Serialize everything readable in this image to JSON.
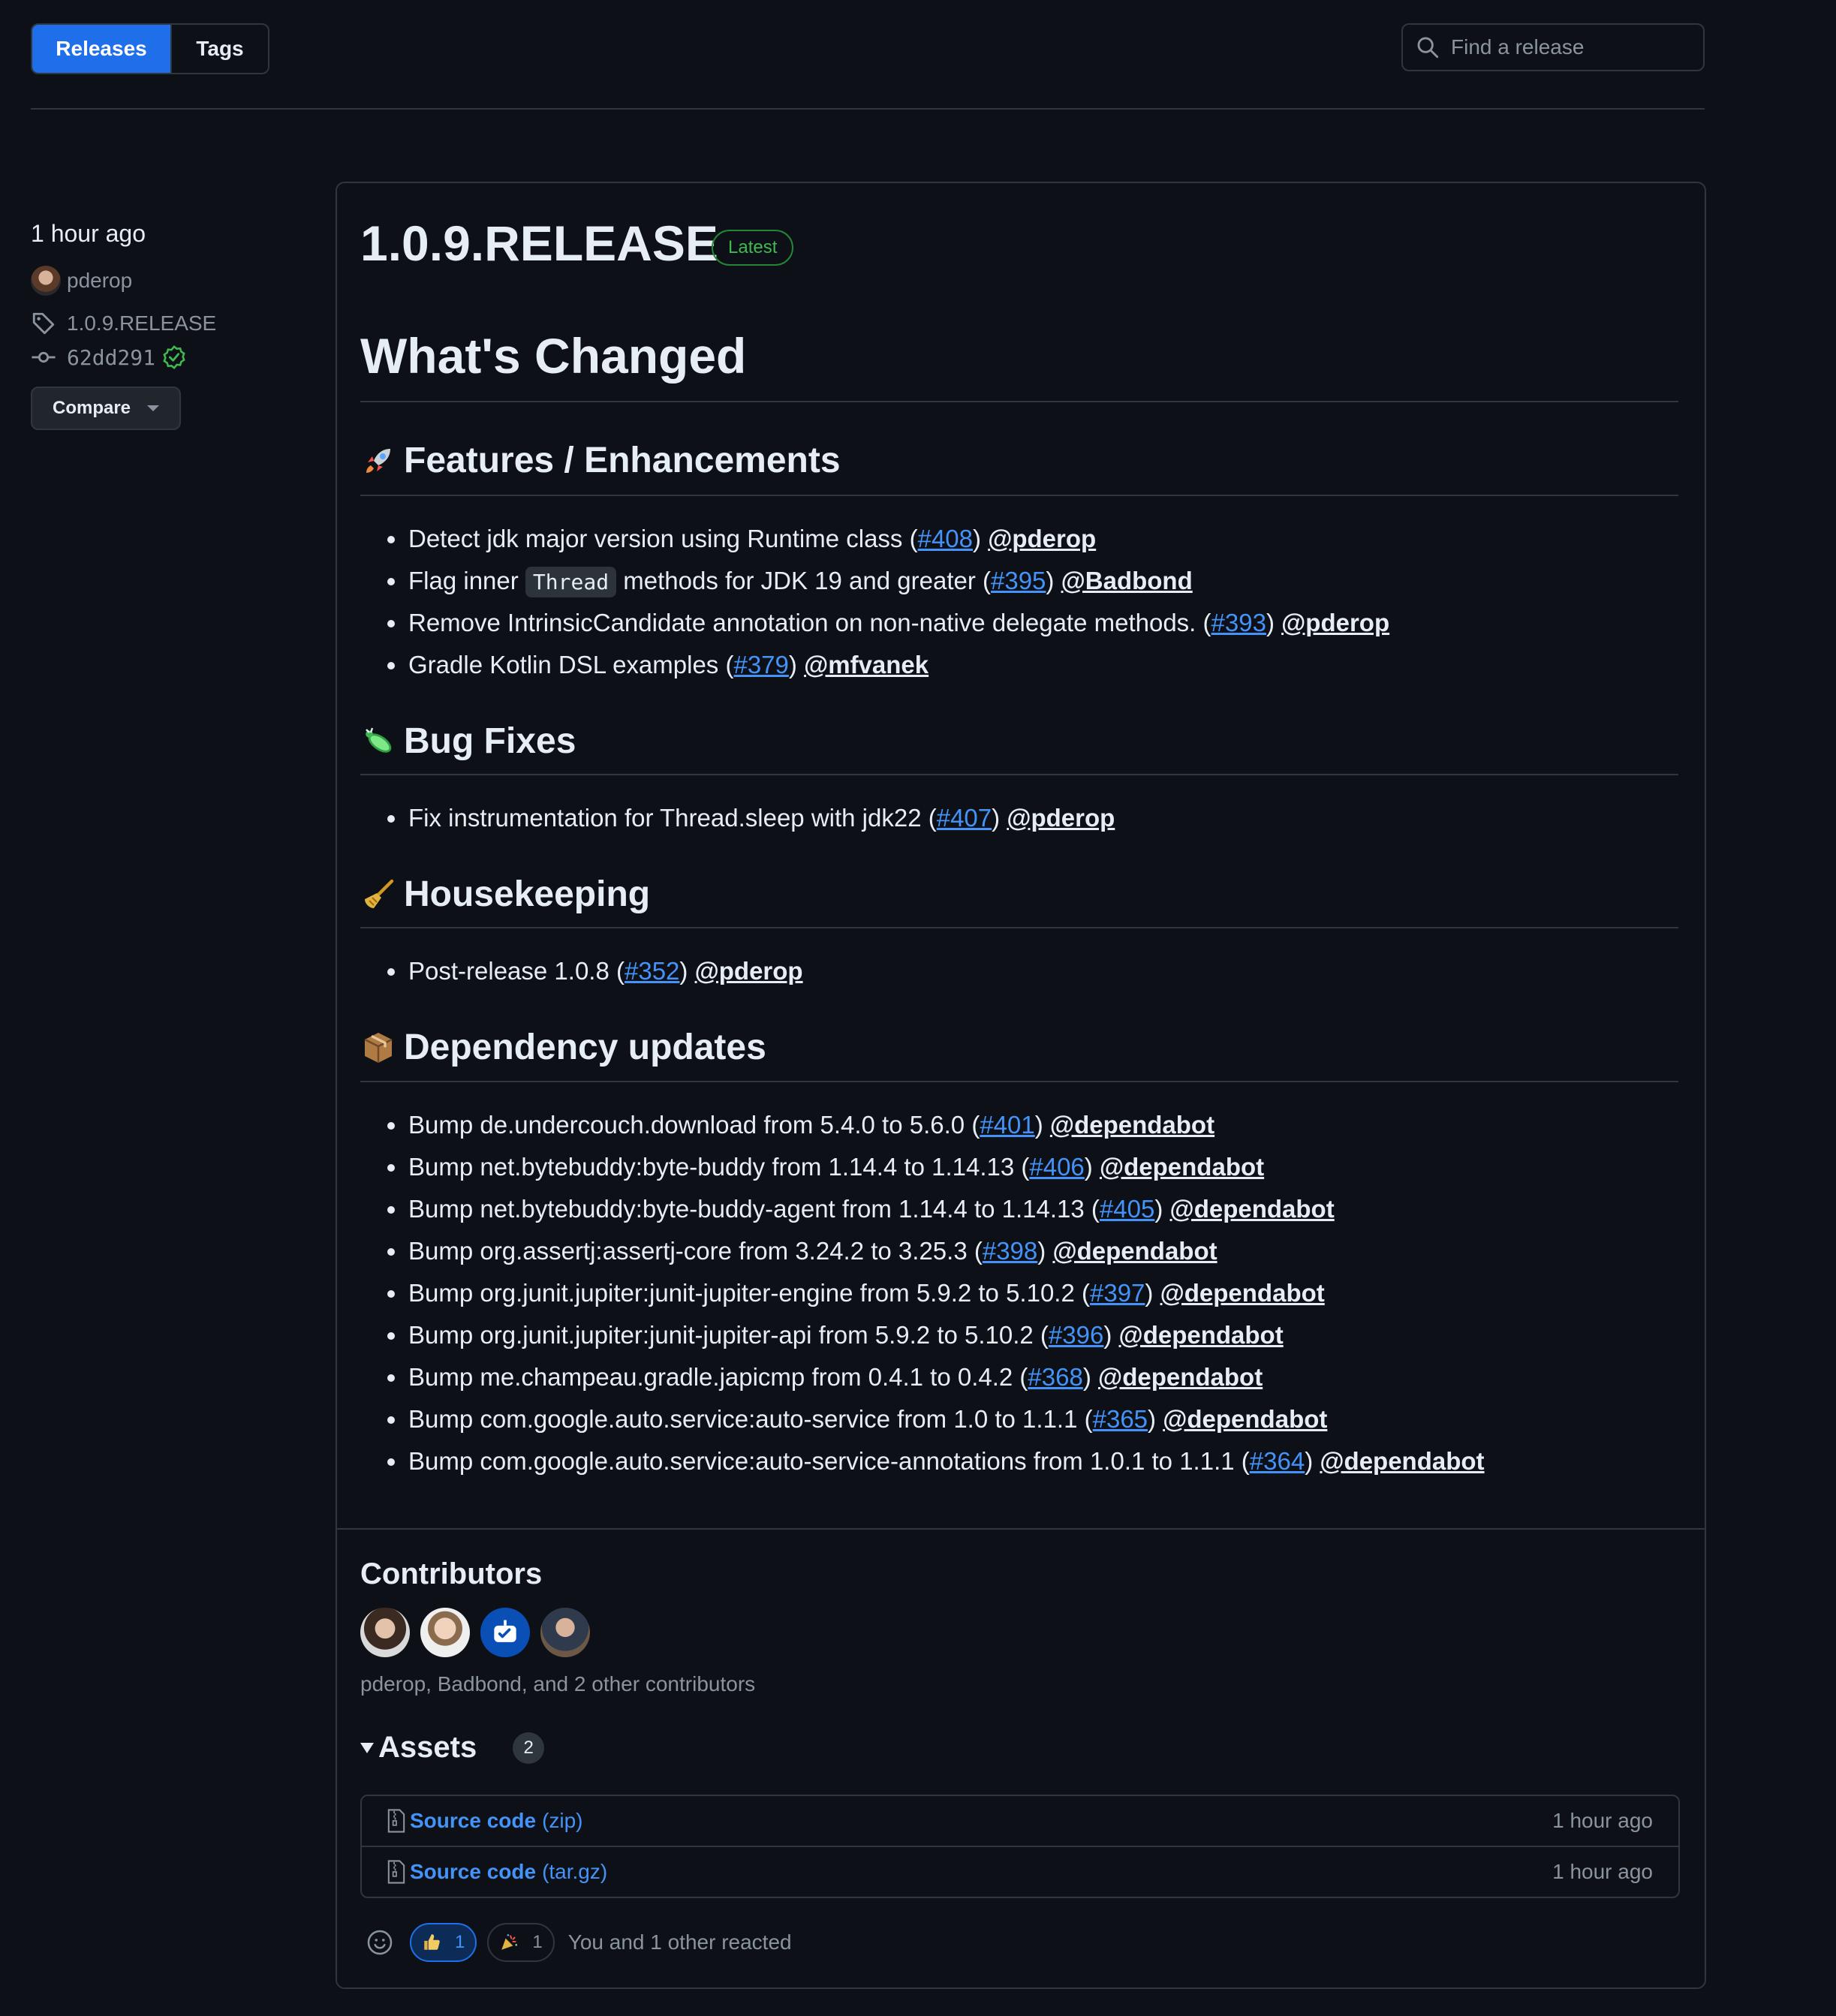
{
  "tabs": [
    {
      "label": "Releases",
      "active": true
    },
    {
      "label": "Tags",
      "active": false
    }
  ],
  "search": {
    "placeholder": "Find a release"
  },
  "meta": {
    "time": "1 hour ago",
    "author": "pderop",
    "tag": "1.0.9.RELEASE",
    "commit": "62dd291",
    "compare_label": "Compare"
  },
  "release": {
    "title": "1.0.9.RELEASE",
    "badge": "Latest",
    "heading": "What's Changed"
  },
  "sections": [
    {
      "title": "Features / Enhancements",
      "icon": "rocket-icon",
      "items": [
        {
          "pre": "Detect jdk major version using Runtime class (",
          "pr": "#408",
          "post": ")",
          "user": "@pderop"
        },
        {
          "pre": "Flag inner ",
          "code": "Thread",
          "mid": " methods for JDK 19 and greater (",
          "pr": "#395",
          "post": ")",
          "user": "@Badbond"
        },
        {
          "pre": "Remove IntrinsicCandidate annotation on non-native delegate methods. (",
          "pr": "#393",
          "post": ")",
          "user": "@pderop"
        },
        {
          "pre": "Gradle Kotlin DSL examples (",
          "pr": "#379",
          "post": ")",
          "user": "@mfvanek"
        }
      ]
    },
    {
      "title": "Bug Fixes",
      "icon": "bug-icon",
      "items": [
        {
          "pre": "Fix instrumentation for Thread.sleep with jdk22 (",
          "pr": "#407",
          "post": ")",
          "user": "@pderop"
        }
      ]
    },
    {
      "title": "Housekeeping",
      "icon": "broom-icon",
      "items": [
        {
          "pre": "Post-release 1.0.8 (",
          "pr": "#352",
          "post": ")",
          "user": "@pderop"
        }
      ]
    },
    {
      "title": "Dependency updates",
      "icon": "package-icon",
      "items": [
        {
          "pre": "Bump de.undercouch.download from 5.4.0 to 5.6.0 (",
          "pr": "#401",
          "post": ")",
          "user": "@dependabot"
        },
        {
          "pre": "Bump net.bytebuddy:byte-buddy from 1.14.4 to 1.14.13 (",
          "pr": "#406",
          "post": ")",
          "user": "@dependabot"
        },
        {
          "pre": "Bump net.bytebuddy:byte-buddy-agent from 1.14.4 to 1.14.13 (",
          "pr": "#405",
          "post": ")",
          "user": "@dependabot"
        },
        {
          "pre": "Bump org.assertj:assertj-core from 3.24.2 to 3.25.3 (",
          "pr": "#398",
          "post": ")",
          "user": "@dependabot"
        },
        {
          "pre": "Bump org.junit.jupiter:junit-jupiter-engine from 5.9.2 to 5.10.2 (",
          "pr": "#397",
          "post": ")",
          "user": "@dependabot"
        },
        {
          "pre": "Bump org.junit.jupiter:junit-jupiter-api from 5.9.2 to 5.10.2 (",
          "pr": "#396",
          "post": ")",
          "user": "@dependabot"
        },
        {
          "pre": "Bump me.champeau.gradle.japicmp from 0.4.1 to 0.4.2 (",
          "pr": "#368",
          "post": ")",
          "user": "@dependabot"
        },
        {
          "pre": "Bump com.google.auto.service:auto-service from 1.0 to 1.1.1 (",
          "pr": "#365",
          "post": ")",
          "user": "@dependabot"
        },
        {
          "pre": "Bump com.google.auto.service:auto-service-annotations from 1.0.1 to 1.1.1 (",
          "pr": "#364",
          "post": ")",
          "user": "@dependabot"
        }
      ]
    }
  ],
  "contributors": {
    "title": "Contributors",
    "summary": "pderop, Badbond, and 2 other contributors"
  },
  "assets": {
    "title": "Assets",
    "count": "2",
    "items": [
      {
        "name": "Source code",
        "ext": "(zip)",
        "time": "1 hour ago"
      },
      {
        "name": "Source code",
        "ext": "(tar.gz)",
        "time": "1 hour ago"
      }
    ]
  },
  "reactions": {
    "thumbs_count": "1",
    "tada_count": "1",
    "summary": "You and 1 other reacted"
  },
  "colors": {
    "background": "#0d1117",
    "border": "#30363d",
    "accent": "#1f6feb",
    "link": "#4493f8",
    "success": "#3fb950"
  }
}
